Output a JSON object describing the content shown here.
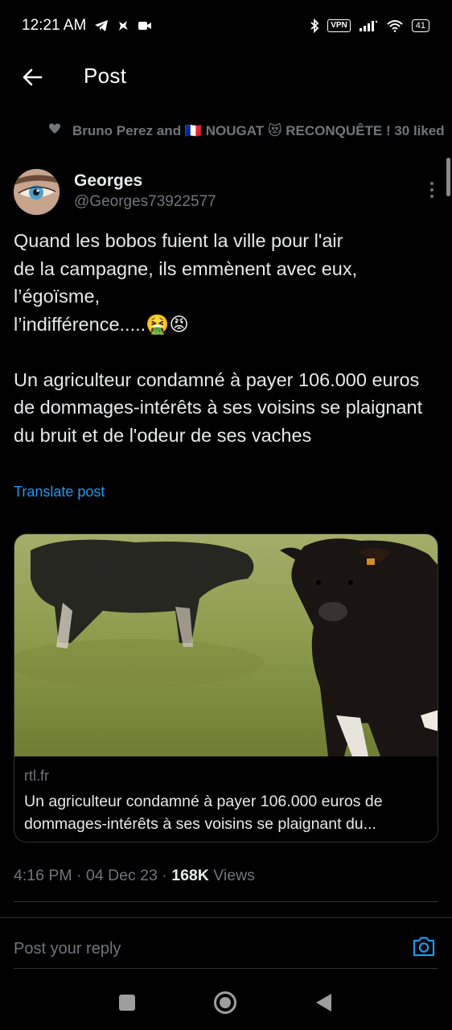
{
  "status_bar": {
    "time": "12:21 AM",
    "vpn": "VPN",
    "battery": "41"
  },
  "header": {
    "title": "Post"
  },
  "social_context": {
    "text": "Bruno Perez and 🇫🇷 NOUGAT 😻 RECONQUÊTE ! 30 liked"
  },
  "author": {
    "name": "Georges",
    "handle": "@Georges73922577"
  },
  "post": {
    "text": "Quand les bobos fuient la ville pour l'air\nde la campagne, ils emmènent avec eux,\nl’égoïsme,\nl’indifférence.....🤮😡\n\nUn agriculteur condamné à payer 106.000 euros de dommages-intérêts à ses voisins se plaignant du bruit et de l'odeur de ses vaches",
    "translate_label": "Translate post"
  },
  "card": {
    "domain": "rtl.fr",
    "title": "Un agriculteur condamné à payer 106.000 euros de dommages-intérêts à ses voisins se plaignant du..."
  },
  "meta": {
    "time": "4:16 PM",
    "date": "04 Dec 23",
    "views_count": "168K",
    "views_label": "Views"
  },
  "reply": {
    "placeholder": "Post your reply"
  },
  "colors": {
    "background": "#000000",
    "text": "#e7e9ea",
    "secondary": "#71767b",
    "accent": "#1d9bf0",
    "border": "#2f3336"
  }
}
